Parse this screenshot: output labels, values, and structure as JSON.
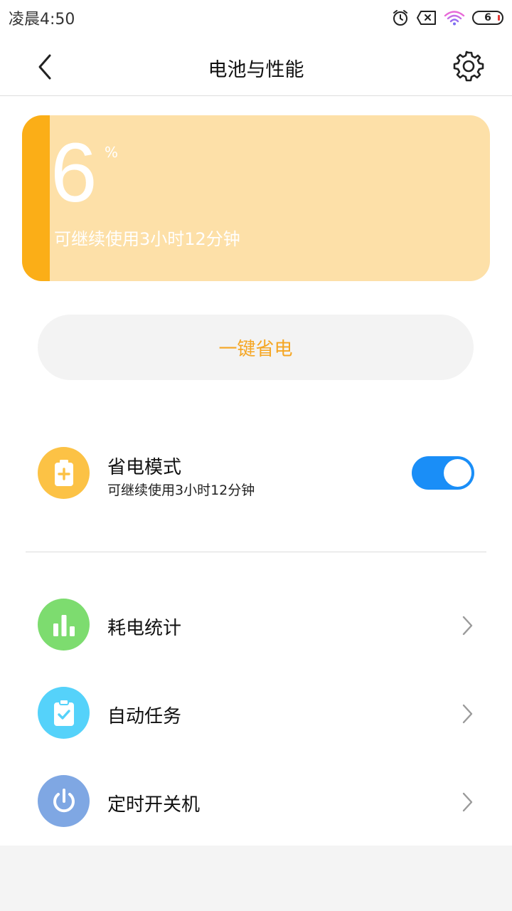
{
  "status_bar": {
    "time": "凌晨4:50",
    "battery_level": "6",
    "icons": [
      "alarm-icon",
      "sim-error-icon",
      "wifi-icon",
      "battery-icon"
    ]
  },
  "header": {
    "title": "电池与性能",
    "back_icon": "chevron-left-icon",
    "settings_icon": "gear-icon"
  },
  "battery_card": {
    "percent": "6",
    "unit": "%",
    "remaining": "可继续使用3小时12分钟",
    "accent_color": "#fbae17",
    "background_color": "#fde0a8"
  },
  "one_tap_save": {
    "label": "一键省电",
    "color": "#f5a623"
  },
  "power_saving": {
    "title": "省电模式",
    "subtitle": "可继续使用3小时12分钟",
    "enabled": true,
    "icon": "battery-plus-icon",
    "icon_color": "#fcc245",
    "toggle_color": "#1a8ef7"
  },
  "menu": [
    {
      "label": "耗电统计",
      "icon": "bar-chart-icon",
      "icon_color": "#7ddc6f"
    },
    {
      "label": "自动任务",
      "icon": "clipboard-check-icon",
      "icon_color": "#55d2fa"
    },
    {
      "label": "定时开关机",
      "icon": "power-icon",
      "icon_color": "#7fa7e3"
    }
  ]
}
